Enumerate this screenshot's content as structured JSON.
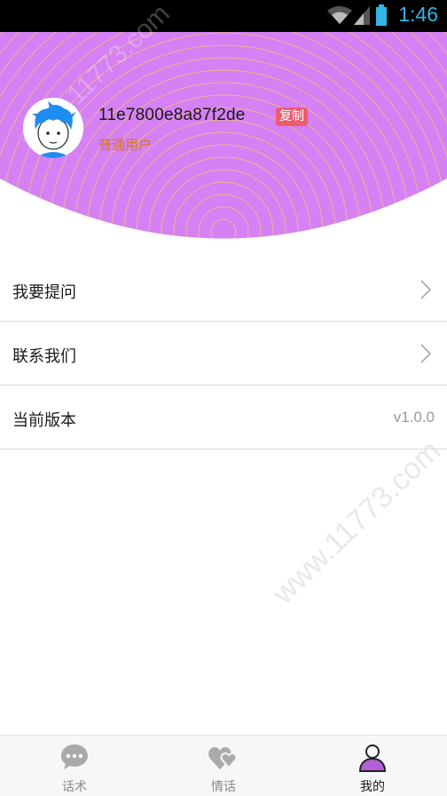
{
  "status_bar": {
    "time": "1:46",
    "icons": [
      "wifi-icon",
      "signal-icon",
      "battery-icon"
    ]
  },
  "profile": {
    "user_id": "11e7800e8a87f2de",
    "copy_label": "复制",
    "role": "普通用户",
    "avatar_icon": "cartoon-boy-avatar"
  },
  "menu": [
    {
      "label": "我要提问",
      "trailing": "chevron-right-icon"
    },
    {
      "label": "联系我们",
      "trailing": "chevron-right-icon"
    },
    {
      "label": "当前版本",
      "value": "v1.0.0"
    }
  ],
  "tabs": [
    {
      "label": "话术",
      "icon": "chat-bubble-icon",
      "active": false
    },
    {
      "label": "情话",
      "icon": "hearts-icon",
      "active": false
    },
    {
      "label": "我的",
      "icon": "person-icon",
      "active": true
    }
  ],
  "watermark": "www.11773.com",
  "colors": {
    "header_purple": "#d580f4",
    "ring_gold": "#f2c66b",
    "copy_red": "#ee5c71",
    "role_orange": "#d17a1f",
    "tab_active": "#b35fd6"
  }
}
